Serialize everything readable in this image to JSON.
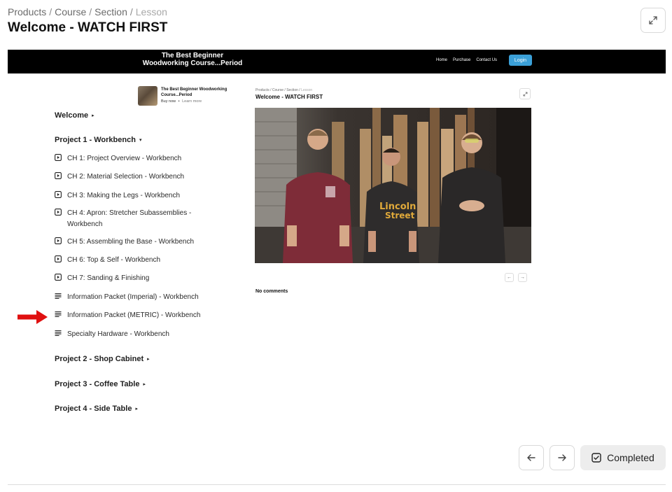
{
  "breadcrumb": {
    "items": [
      "Products",
      "Course",
      "Section"
    ],
    "current": "Lesson",
    "separator": "/"
  },
  "page_title": "Welcome - WATCH FIRST",
  "embed": {
    "site_title_line1": "The Best Beginner",
    "site_title_line2": "Woodworking Course...Period",
    "nav": {
      "home": "Home",
      "purchase": "Purchase",
      "contact": "Contact Us",
      "login": "Login"
    },
    "course_card": {
      "name": "The Best Beginner Woodworking Course...Period",
      "buy": "Buy now",
      "dot": "•",
      "learn": "Learn more"
    },
    "mini_breadcrumb": {
      "items": [
        "Products",
        "Course",
        "Section"
      ],
      "current": "Lesson"
    },
    "mini_title": "Welcome - WATCH FIRST",
    "no_comments": "No comments",
    "outline": {
      "sections": [
        {
          "label": "Welcome",
          "caret": "▸"
        },
        {
          "label": "Project 1 - Workbench",
          "caret": "▾"
        },
        {
          "label": "Project 2 - Shop Cabinet",
          "caret": "▸"
        },
        {
          "label": "Project 3 - Coffee Table",
          "caret": "▸"
        },
        {
          "label": "Project 4 - Side Table",
          "caret": "▸"
        }
      ],
      "lessons": [
        {
          "label": "CH 1: Project Overview - Workbench",
          "icon": "video-icon"
        },
        {
          "label": "CH 2: Material Selection - Workbench",
          "icon": "video-icon"
        },
        {
          "label": "CH 3: Making the Legs - Workbench",
          "icon": "video-icon"
        },
        {
          "label": "CH 4: Apron: Stretcher Subassemblies - Workbench",
          "icon": "video-icon"
        },
        {
          "label": "CH 5: Assembling the Base - Workbench",
          "icon": "video-icon"
        },
        {
          "label": "CH 6: Top & Self - Workbench",
          "icon": "video-icon"
        },
        {
          "label": "CH 7: Sanding & Finishing",
          "icon": "video-icon"
        },
        {
          "label": "Information Packet (Imperial) - Workbench",
          "icon": "text-icon"
        },
        {
          "label": "Information Packet (METRIC) - Workbench",
          "icon": "text-icon"
        },
        {
          "label": "Specialty Hardware - Workbench",
          "icon": "text-icon"
        }
      ]
    },
    "video": {
      "shirt_text_line1": "Lincoln",
      "shirt_text_line2": "Street"
    }
  },
  "footer": {
    "prev_icon": "arrow-left-icon",
    "next_icon": "arrow-right-icon",
    "completed_label": "Completed"
  },
  "colors": {
    "arrow": "#e01010",
    "login": "#3ba0d8",
    "header_bg": "#000000"
  }
}
